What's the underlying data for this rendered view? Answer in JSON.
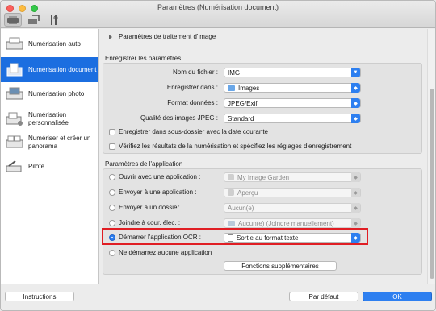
{
  "window": {
    "title": "Paramètres (Numérisation document)"
  },
  "toolbar": {
    "icons": [
      "scan-settings-icon",
      "general-settings-icon",
      "tools-icon"
    ]
  },
  "sidebar": {
    "items": [
      {
        "label": "Numérisation auto",
        "active": false
      },
      {
        "label": "Numérisation document",
        "active": true
      },
      {
        "label": "Numérisation photo",
        "active": false
      },
      {
        "label": "Numérisation personnalisée",
        "active": false
      },
      {
        "label": "Numériser et créer un panorama",
        "active": false
      },
      {
        "label": "Pilote",
        "active": false
      }
    ]
  },
  "main": {
    "image_processing": "Paramètres de traitement d'image",
    "save_section": {
      "title": "Enregistrer les paramètres",
      "filename_label": "Nom du fichier :",
      "filename_value": "IMG",
      "save_in_label": "Enregistrer dans :",
      "save_in_value": "Images",
      "format_label": "Format données :",
      "format_value": "JPEG/Exif",
      "quality_label": "Qualité des images JPEG :",
      "quality_value": "Standard",
      "check_subfolder": "Enregistrer dans sous-dossier avec la date courante",
      "check_verify": "Vérifiez les résultats de la numérisation et spécifiez les réglages d'enregistrement"
    },
    "app_section": {
      "title": "Paramètres de l'application",
      "open_app_label": "Ouvrir avec une application :",
      "open_app_value": "My Image Garden",
      "send_app_label": "Envoyer à une application :",
      "send_app_value": "Aperçu",
      "send_folder_label": "Envoyer à un dossier :",
      "send_folder_value": "Aucun(e)",
      "attach_email_label": "Joindre à cour. élec. :",
      "attach_email_value": "Aucun(e) (Joindre manuellement)",
      "ocr_label": "Démarrer l'application OCR :",
      "ocr_value": "Sortie au format texte",
      "no_app_label": "Ne démarrez aucune application",
      "more_functions": "Fonctions supplémentaires"
    }
  },
  "footer": {
    "instructions": "Instructions",
    "default": "Par défaut",
    "ok": "OK"
  }
}
